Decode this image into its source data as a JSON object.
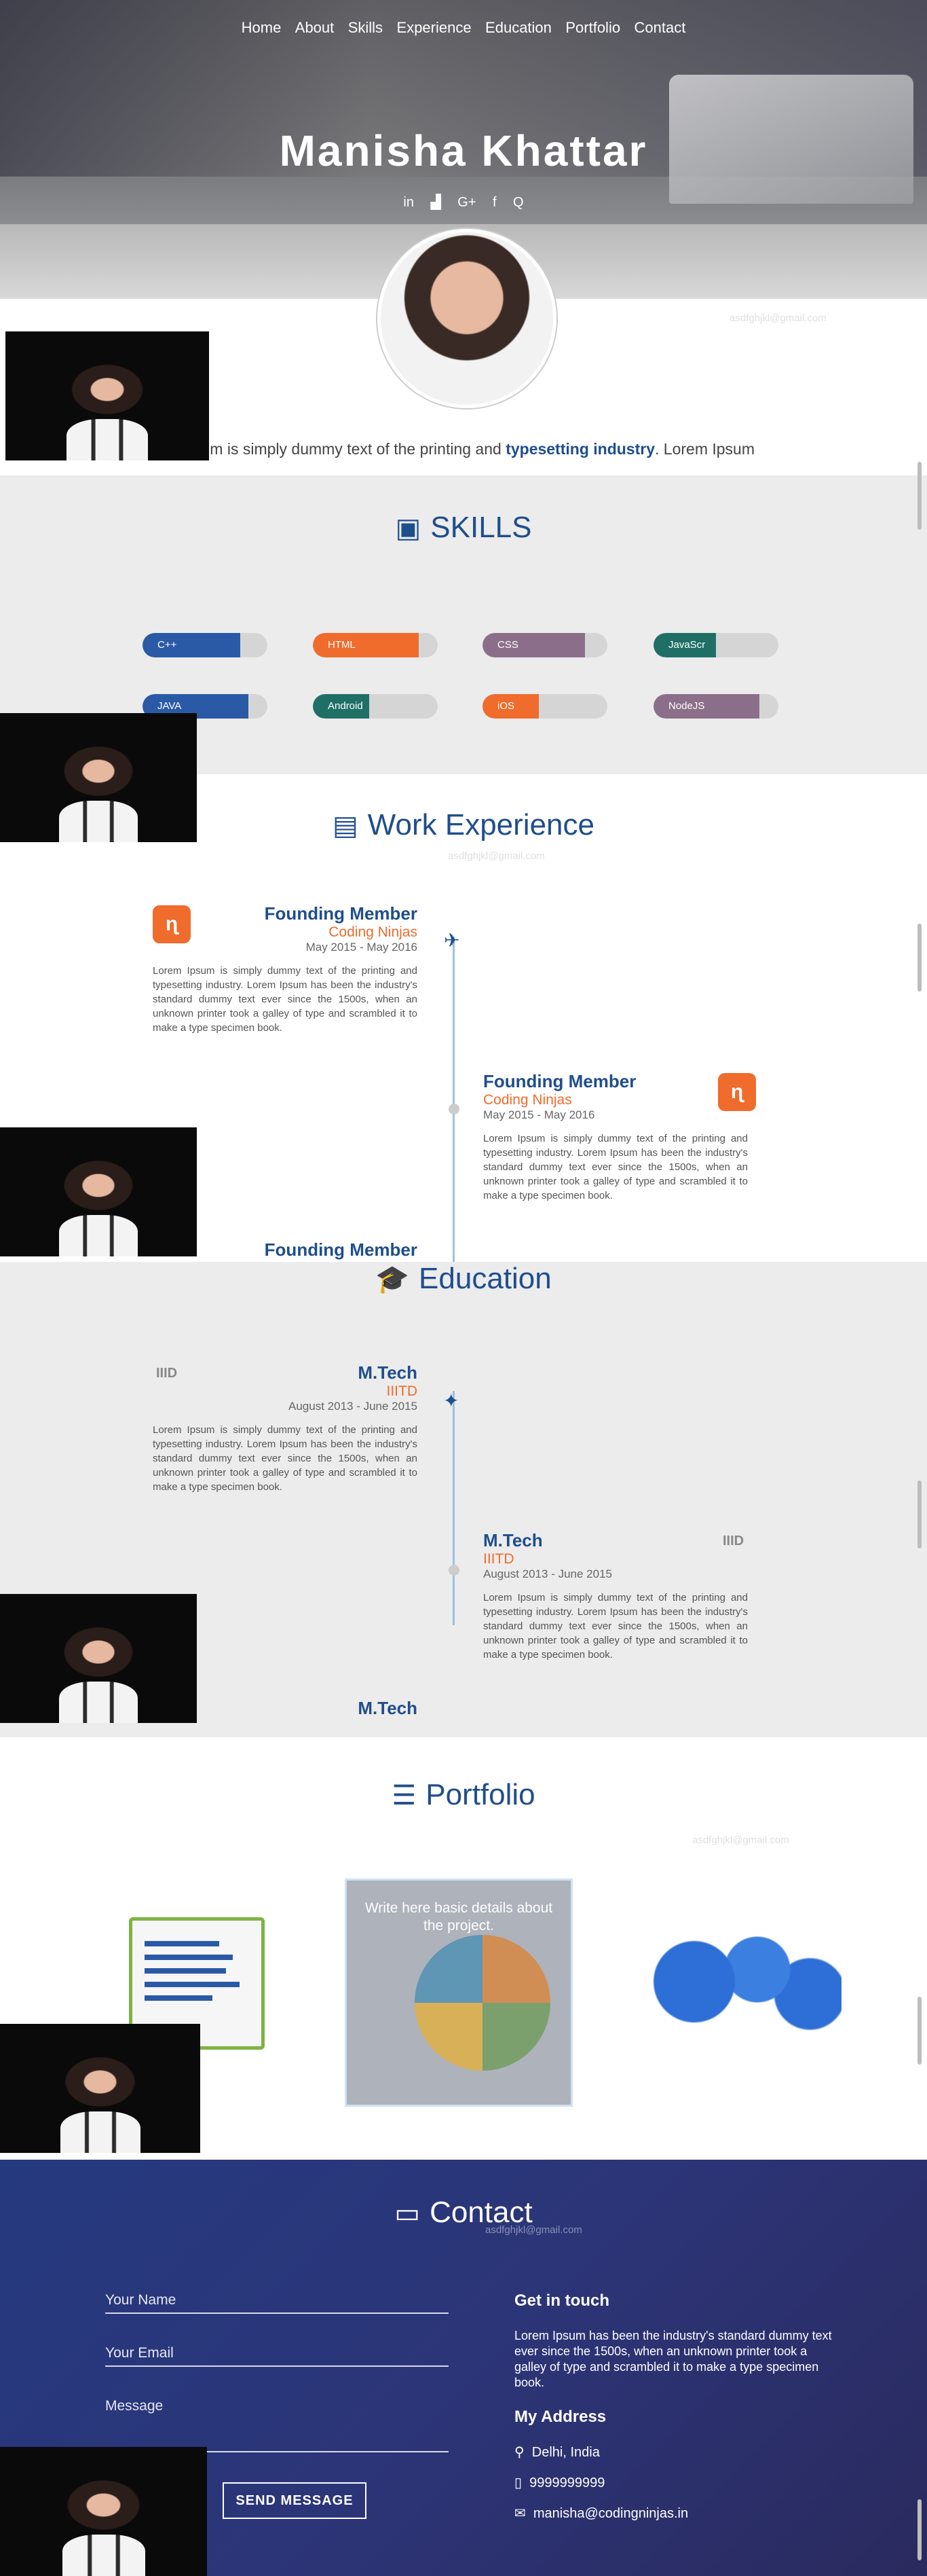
{
  "nav": {
    "items": [
      "Home",
      "About",
      "Skills",
      "Experience",
      "Education",
      "Portfolio",
      "Contact"
    ]
  },
  "hero": {
    "name": "Manisha Khattar",
    "socials": [
      "linkedin-icon",
      "stackoverflow-icon",
      "google-plus-icon",
      "facebook-icon",
      "quora-icon"
    ],
    "social_glyphs": [
      "in",
      "▟",
      "G+",
      "f",
      "Q"
    ]
  },
  "about": {
    "faint_email": "asdfghjkl@gmail.com",
    "intro_pre": "sum is simply dummy text of the printing and ",
    "intro_bold": "typesetting industry",
    "intro_post": ". Lorem Ipsum"
  },
  "skills": {
    "title": "SKILLS",
    "items": [
      {
        "label": "C++",
        "level": 0.78,
        "color": "#2a5aa6"
      },
      {
        "label": "HTML",
        "level": 0.85,
        "color": "#ef6c2c"
      },
      {
        "label": "CSS",
        "level": 0.82,
        "color": "#8b6f8a"
      },
      {
        "label": "JavaScr",
        "level": 0.5,
        "color": "#1f6f67"
      },
      {
        "label": "JAVA",
        "level": 0.85,
        "color": "#2a5aa6"
      },
      {
        "label": "Android",
        "level": 0.45,
        "color": "#1f6f67"
      },
      {
        "label": "iOS",
        "level": 0.45,
        "color": "#ef6c2c"
      },
      {
        "label": "NodeJS",
        "level": 0.85,
        "color": "#8b6f8a"
      }
    ]
  },
  "work": {
    "title": "Work Experience",
    "faint_email": "asdfghjkl@gmail.com",
    "entries": [
      {
        "title": "Founding Member",
        "org": "Coding Ninjas",
        "date": "May 2015 - May 2016",
        "desc": "Lorem Ipsum is simply dummy text of the printing and typesetting industry. Lorem Ipsum has been the industry's standard dummy text ever since the 1500s, when an unknown printer took a galley of type and scrambled it to make a type specimen book."
      },
      {
        "title": "Founding Member",
        "org": "Coding Ninjas",
        "date": "May 2015 - May 2016",
        "desc": "Lorem Ipsum is simply dummy text of the printing and typesetting industry. Lorem Ipsum has been the industry's standard dummy text ever since the 1500s, when an unknown printer took a galley of type and scrambled it to make a type specimen book."
      },
      {
        "title": "Founding Member"
      }
    ]
  },
  "education": {
    "title": "Education",
    "logo_text": "IIID",
    "entries": [
      {
        "title": "M.Tech",
        "org": "IIITD",
        "date": "August 2013 - June 2015",
        "desc": "Lorem Ipsum is simply dummy text of the printing and typesetting industry. Lorem Ipsum has been the industry's standard dummy text ever since the 1500s, when an unknown printer took a galley of type and scrambled it to make a type specimen book."
      },
      {
        "title": "M.Tech",
        "org": "IIITD",
        "date": "August 2013 - June 2015",
        "desc": "Lorem Ipsum is simply dummy text of the printing and typesetting industry. Lorem Ipsum has been the industry's standard dummy text ever since the 1500s, when an unknown printer took a galley of type and scrambled it to make a type specimen book."
      },
      {
        "title": "M.Tech"
      }
    ]
  },
  "portfolio": {
    "title": "Portfolio",
    "faint_email": "asdfghjkl@gmail.com",
    "hover_text": "Write here basic details about the project."
  },
  "contact": {
    "title": "Contact",
    "faint_email": "asdfghjkl@gmail.com",
    "name_placeholder": "Your Name",
    "email_placeholder": "Your Email",
    "message_placeholder": "Message",
    "send_label": "SEND MESSAGE",
    "get_in_touch": "Get in touch",
    "touch_text": "Lorem Ipsum has been the industry's standard dummy text ever since the 1500s, when an unknown printer took a galley of type and scrambled it to make a type specimen book.",
    "address_title": "My Address",
    "address": "Delhi, India",
    "phone": "9999999999",
    "email": "manisha@codingninjas.in"
  }
}
